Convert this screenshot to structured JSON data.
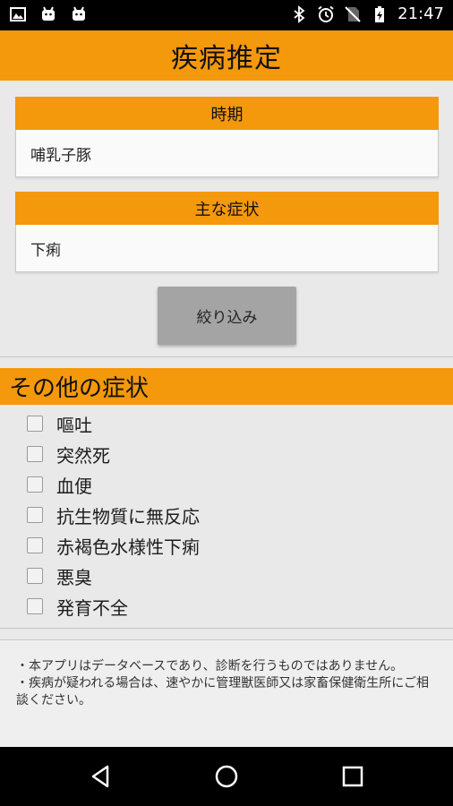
{
  "status_bar": {
    "time": "21:47",
    "icons": [
      "image-icon",
      "android-icon",
      "android-icon",
      "bluetooth-icon",
      "alarm-icon",
      "no-sim-icon",
      "battery-charging-icon"
    ]
  },
  "header": {
    "title": "疾病推定"
  },
  "period": {
    "label": "時期",
    "value": "哺乳子豚"
  },
  "main_symptom": {
    "label": "主な症状",
    "value": "下痢"
  },
  "filter_button": {
    "label": "絞り込み"
  },
  "other_symptoms": {
    "title": "その他の症状",
    "items": [
      {
        "label": "嘔吐",
        "checked": false
      },
      {
        "label": "突然死",
        "checked": false
      },
      {
        "label": "血便",
        "checked": false
      },
      {
        "label": "抗生物質に無反応",
        "checked": false
      },
      {
        "label": "赤褐色水様性下痢",
        "checked": false
      },
      {
        "label": "悪臭",
        "checked": false
      },
      {
        "label": "発育不全",
        "checked": false
      }
    ]
  },
  "notes": {
    "line1": "・本アプリはデータベースであり、診断を行うものではありません。",
    "line2": "・疾病が疑われる場合は、速やかに管理獣医師又は家畜保健衛生所にご相談ください。"
  },
  "colors": {
    "accent": "#f4980c",
    "background": "#e9e9e9",
    "button": "#a4a4a4"
  },
  "nav_bar": {
    "buttons": [
      "back-icon",
      "home-icon",
      "recents-icon"
    ]
  }
}
